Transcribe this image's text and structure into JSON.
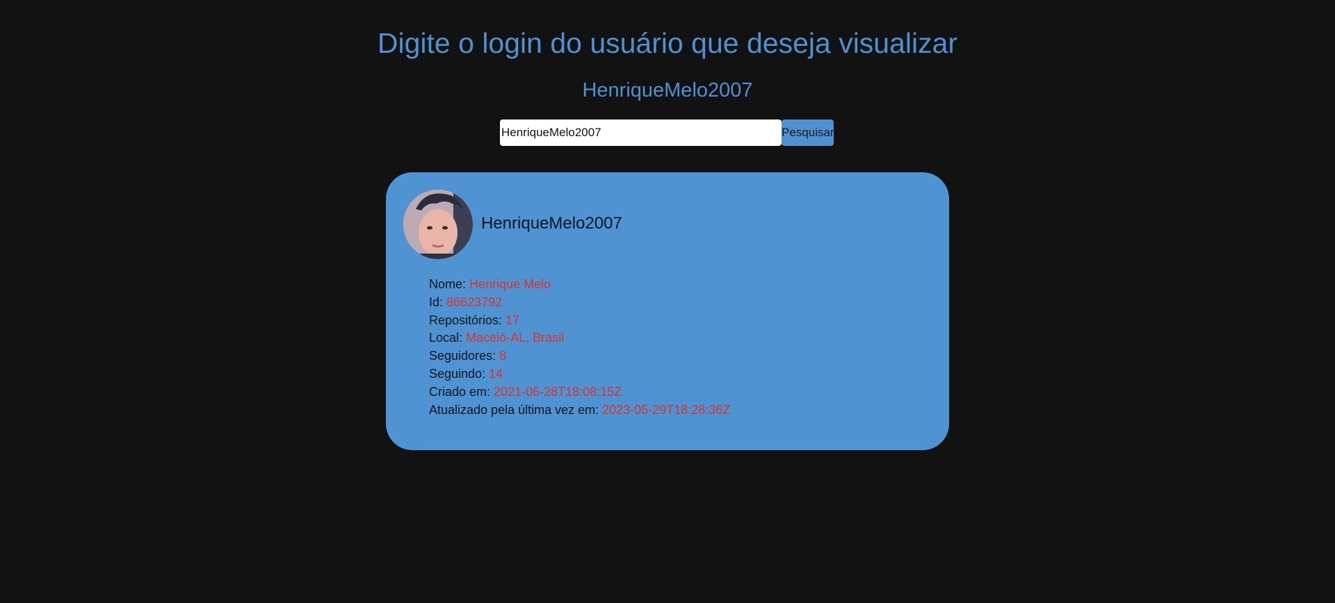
{
  "header": {
    "title": "Digite o login do usuário que deseja visualizar",
    "subtitle": "HenriqueMelo2007"
  },
  "search": {
    "value": "HenriqueMelo2007",
    "button_label": "Pesquisar"
  },
  "profile": {
    "username": "HenriqueMelo2007",
    "fields": [
      {
        "label": "Nome:",
        "value": "Henrique Melo"
      },
      {
        "label": "Id:",
        "value": "86623792"
      },
      {
        "label": "Repositórios:",
        "value": "17"
      },
      {
        "label": "Local:",
        "value": "Maceió-AL, Brasil"
      },
      {
        "label": "Seguidores:",
        "value": "8"
      },
      {
        "label": "Seguindo:",
        "value": "14"
      },
      {
        "label": "Criado em:",
        "value": "2021-06-28T18:08:15Z"
      },
      {
        "label": "Atualizado pela última vez em:",
        "value": "2023-05-29T18:28:36Z"
      }
    ]
  },
  "colors": {
    "background": "#121212",
    "accent": "#4f91d1",
    "card": "#4f93d2",
    "value_text": "#d8342f"
  }
}
